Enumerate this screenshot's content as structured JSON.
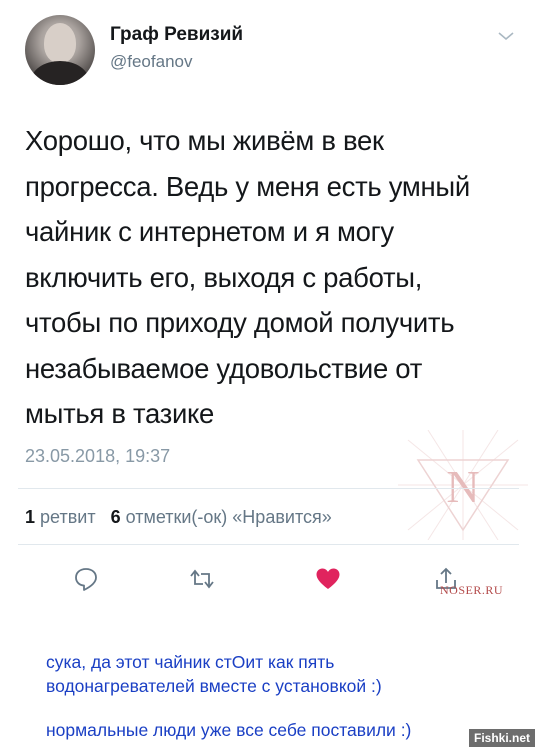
{
  "tweet": {
    "author_name": "Граф Ревизий",
    "author_handle": "@feofanov",
    "text": "Хорошо, что мы живём в век\nпрогресса. Ведь у меня есть умный\nчайник с интернетом и я могу\nвключить его, выходя с работы,\nчтобы по приходу домой получить\nнезабываемое удовольствие от\nмытья в тазике",
    "timestamp": "23.05.2018, 19:37",
    "retweet_count": "1",
    "retweet_label": "ретвит",
    "like_count": "6",
    "like_label": "отметки(-ок) «Нравится»"
  },
  "icons": {
    "reply": "reply-icon",
    "retweet": "retweet-icon",
    "like": "heart-icon",
    "share": "share-icon",
    "menu": "chevron-down-icon"
  },
  "colors": {
    "like": "#e0245e",
    "secondary": "#657786",
    "comment": "#1a3fc4"
  },
  "watermark": {
    "site": "NOSER.RU",
    "letter": "N"
  },
  "comments": [
    "сука, да этот чайник стОит как пять\nводонагревателей вместе с установкой :)",
    "нормальные люди уже все себе поставили :)"
  ],
  "corner_watermark": "Fishki.net"
}
